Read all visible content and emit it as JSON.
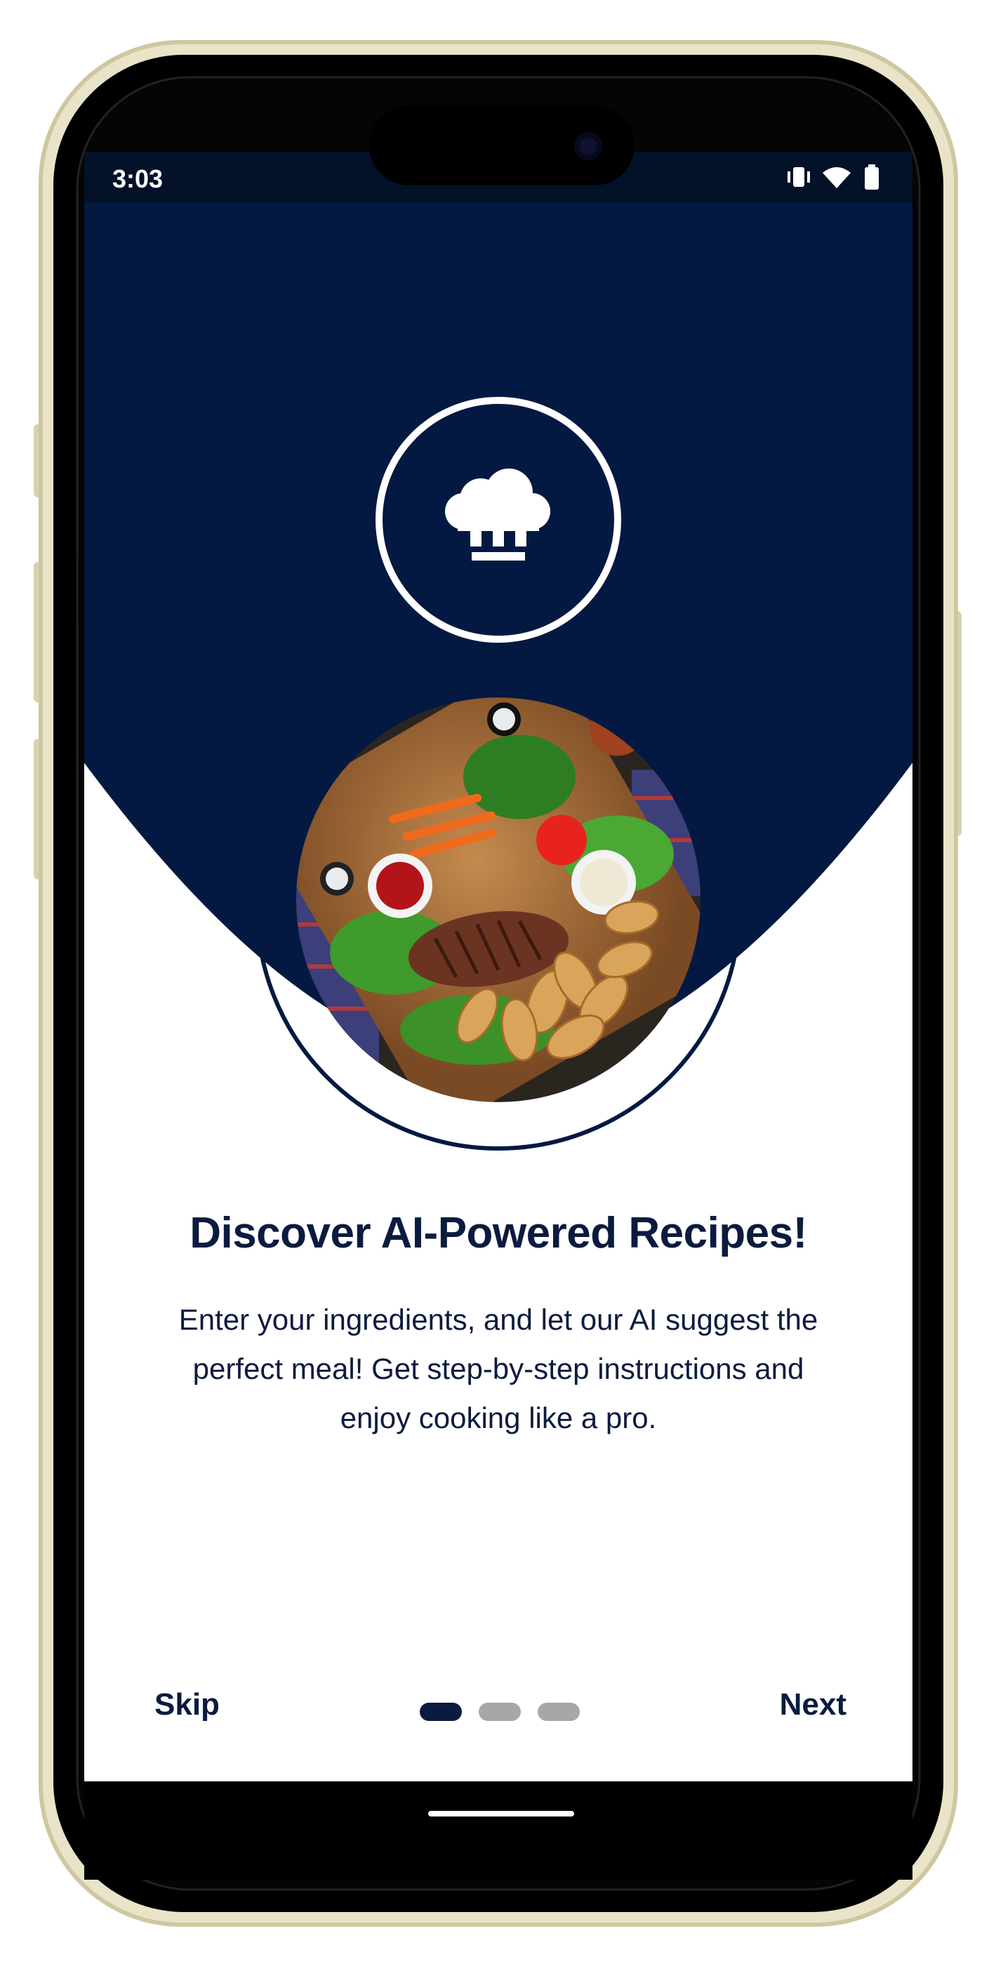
{
  "status_bar": {
    "time": "3:03",
    "icons": [
      "vibrate-icon",
      "wifi-icon",
      "battery-icon"
    ]
  },
  "onboarding": {
    "logo_icon": "chef-hat-icon",
    "image_alt": "food-platter-image",
    "title": "Discover AI-Powered Recipes!",
    "description_lines": [
      "Enter your ingredients, and let our AI suggest the",
      "perfect meal! Get step-by-step instructions and",
      "enjoy cooking like a pro."
    ],
    "page_indicator": {
      "current": 1,
      "total": 3
    }
  },
  "actions": {
    "skip_label": "Skip",
    "next_label": "Next"
  },
  "colors": {
    "primary": "#031942",
    "text": "#0B1B3F",
    "inactive_dot": "#a7a7a7",
    "device_frame": "#e7e1c4"
  }
}
